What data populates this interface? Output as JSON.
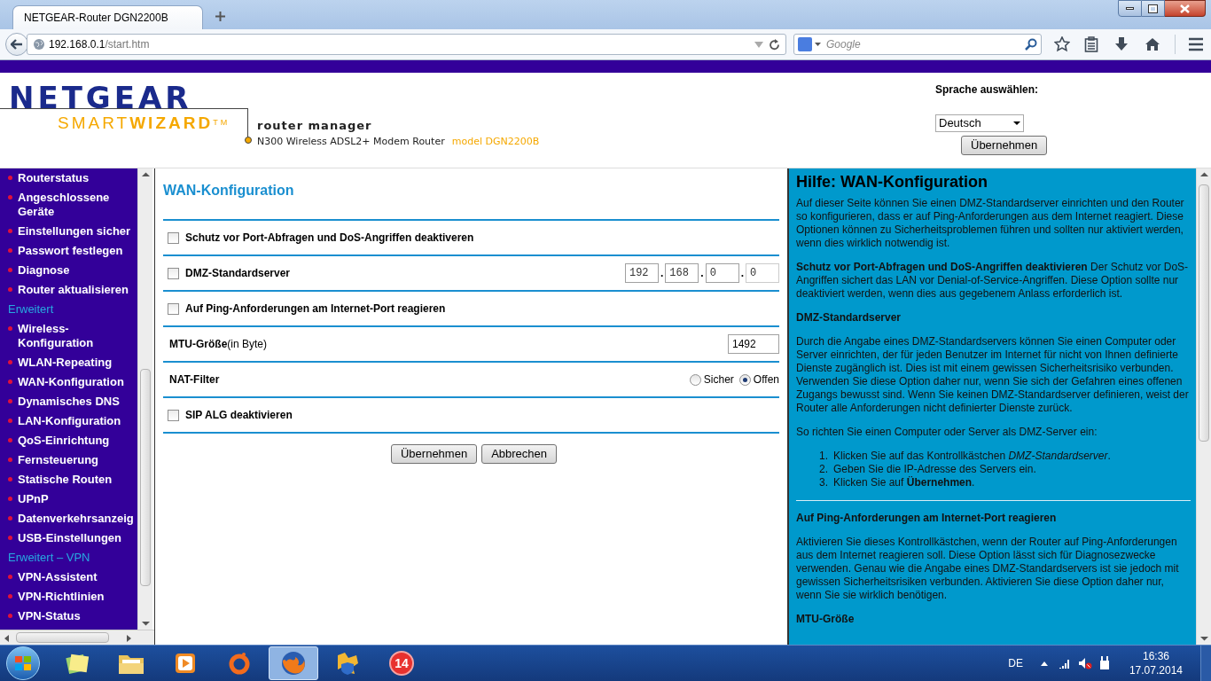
{
  "browser": {
    "tab_title": "NETGEAR-Router DGN2200B",
    "url_host": "192.168.0.1",
    "url_path": "/start.htm",
    "search_placeholder": "Google"
  },
  "header": {
    "brand": "NETGEAR",
    "product": "SMART**WIZARD**$^{TM}$",
    "tagline": "router manager",
    "model_desc": "N300 Wireless ADSL2+ Modem Router",
    "model": "model DGN2200B",
    "language_label": "Sprache auswählen:",
    "language_value": "Deutsch",
    "apply": "Übernehmen"
  },
  "sidebar": [
    {
      "kind": "link",
      "label": "Routerstatus"
    },
    {
      "kind": "link",
      "label": "Angeschlossene Geräte"
    },
    {
      "kind": "link",
      "label": "Einstellungen sicher"
    },
    {
      "kind": "link",
      "label": "Passwort festlegen"
    },
    {
      "kind": "link",
      "label": "Diagnose"
    },
    {
      "kind": "link",
      "label": "Router aktualisieren"
    },
    {
      "kind": "heading",
      "label": "Erweitert"
    },
    {
      "kind": "link",
      "label": "Wireless-Konfiguration"
    },
    {
      "kind": "link",
      "label": "WLAN-Repeating"
    },
    {
      "kind": "link",
      "label": "WAN-Konfiguration"
    },
    {
      "kind": "link",
      "label": "Dynamisches DNS"
    },
    {
      "kind": "link",
      "label": "LAN-Konfiguration"
    },
    {
      "kind": "link",
      "label": "QoS-Einrichtung"
    },
    {
      "kind": "link",
      "label": "Fernsteuerung"
    },
    {
      "kind": "link",
      "label": "Statische Routen"
    },
    {
      "kind": "link",
      "label": "UPnP"
    },
    {
      "kind": "link",
      "label": "Datenverkehrsanzeig"
    },
    {
      "kind": "link",
      "label": "USB-Einstellungen"
    },
    {
      "kind": "heading",
      "label": "Erweitert – VPN"
    },
    {
      "kind": "link",
      "label": "VPN-Assistent"
    },
    {
      "kind": "link",
      "label": "VPN-Richtlinien"
    },
    {
      "kind": "link",
      "label": "VPN-Status"
    }
  ],
  "main": {
    "title": "WAN-Konfiguration",
    "rows": [
      {
        "kind": "checkbox",
        "label": "Schutz vor Port-Abfragen und DoS-Angriffen deaktiveren",
        "checked": false
      },
      {
        "kind": "checkbox",
        "label": "DMZ-Standardserver",
        "checked": false,
        "ip": [
          "192",
          ".",
          "168",
          ".",
          "0",
          ".",
          "0"
        ]
      },
      {
        "kind": "checkbox",
        "label": "Auf Ping-Anforderungen am Internet-Port reagieren",
        "checked": false
      },
      {
        "kind": "input",
        "label": "**MTU-Größe**(in Byte)",
        "value": "1492"
      },
      {
        "kind": "radio",
        "label": "NAT-Filter",
        "options": [
          {
            "label": "Sicher",
            "selected": false
          },
          {
            "label": "Offen",
            "selected": true
          }
        ]
      },
      {
        "kind": "checkbox",
        "label": "SIP ALG deaktivieren",
        "checked": false
      }
    ],
    "buttons": [
      "Übernehmen",
      "Abbrechen"
    ]
  },
  "help": {
    "title": "Hilfe: WAN-Konfiguration",
    "blocks": [
      {
        "kind": "p",
        "text": "Auf dieser Seite können Sie einen DMZ-Standardserver einrichten und den Router so konfigurieren, dass er auf Ping-Anforderungen aus dem Internet reagiert. Diese Optionen können zu Sicherheitsproblemen führen und sollten nur aktiviert werden, wenn dies wirklich notwendig ist."
      },
      {
        "kind": "p",
        "text": "**Schutz vor Port-Abfragen und DoS-Angriffen deaktivieren** Der Schutz vor DoS-Angriffen sichert das LAN vor Denial-of-Service-Angriffen. Diese Option sollte nur deaktiviert werden, wenn dies aus gegebenem Anlass erforderlich ist."
      },
      {
        "kind": "h",
        "text": "DMZ-Standardserver"
      },
      {
        "kind": "p",
        "text": "Durch die Angabe eines DMZ-Standardservers können Sie einen Computer oder Server einrichten, der für jeden Benutzer im Internet für nicht von Ihnen definierte Dienste zugänglich ist. Dies ist mit einem gewissen Sicherheitsrisiko verbunden. Verwenden Sie diese Option daher nur, wenn Sie sich der Gefahren eines offenen Zugangs bewusst sind. Wenn Sie keinen DMZ-Standardserver definieren, weist der Router alle Anforderungen nicht definierter Dienste zurück."
      },
      {
        "kind": "p",
        "text": "So richten Sie einen Computer oder Server als DMZ-Server ein:"
      },
      {
        "kind": "ol",
        "items": [
          {
            "number": "1.",
            "text": "Klicken Sie auf das Kontrollkästchen *DMZ-Standardserver*."
          },
          {
            "number": "2.",
            "text": "Geben Sie die IP-Adresse des Servers ein."
          },
          {
            "number": "3.",
            "text": "Klicken Sie auf **Übernehmen**."
          }
        ]
      },
      {
        "kind": "hr"
      },
      {
        "kind": "h",
        "text": "Auf Ping-Anforderungen am Internet-Port reagieren"
      },
      {
        "kind": "p",
        "text": "Aktivieren Sie dieses Kontrollkästchen, wenn der Router auf Ping-Anforderungen aus dem Internet reagieren soll. Diese Option lässt sich für Diagnosezwecke verwenden. Genau wie die Angabe eines DMZ-Standardservers ist sie jedoch mit gewissen Sicherheitsrisiken verbunden. Aktivieren Sie diese Option daher nur, wenn Sie sie wirklich benötigen."
      },
      {
        "kind": "h",
        "text": "MTU-Größe"
      }
    ]
  },
  "taskbar": {
    "apps": [
      {
        "kind": "notes",
        "active": false
      },
      {
        "kind": "folder",
        "active": false
      },
      {
        "kind": "media",
        "active": false
      },
      {
        "kind": "ring",
        "active": false
      },
      {
        "kind": "browser",
        "active": true
      },
      {
        "kind": "game",
        "active": false
      },
      {
        "kind": "badge",
        "label": "14",
        "active": false
      }
    ],
    "language": "DE",
    "time": "16:36",
    "date": "17.07.2014"
  }
}
